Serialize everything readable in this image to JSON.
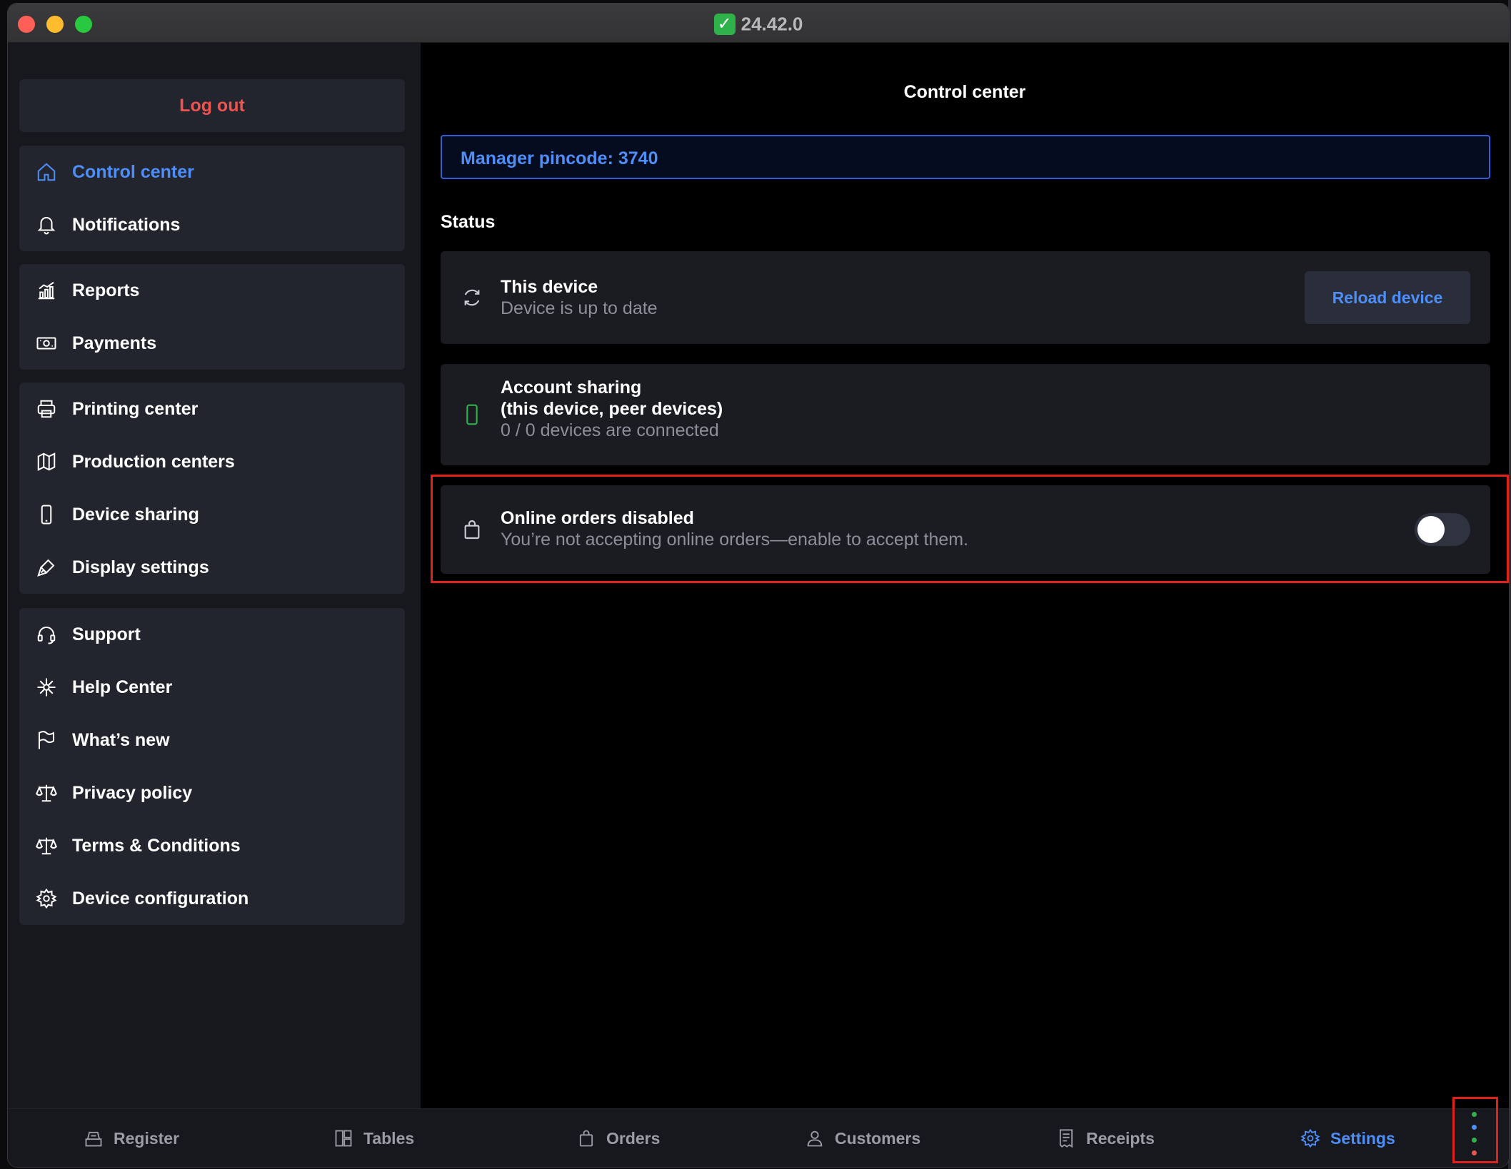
{
  "window": {
    "title": "24.42.0",
    "title_icon": "check-mark-icon"
  },
  "sidebar": {
    "logout_label": "Log out",
    "groups": [
      [
        {
          "label": "Control center",
          "icon": "home-icon",
          "active": true
        },
        {
          "label": "Notifications",
          "icon": "bell-icon"
        }
      ],
      [
        {
          "label": "Reports",
          "icon": "chart-icon"
        },
        {
          "label": "Payments",
          "icon": "cash-icon"
        }
      ],
      [
        {
          "label": "Printing center",
          "icon": "printer-icon"
        },
        {
          "label": "Production centers",
          "icon": "map-icon"
        },
        {
          "label": "Device sharing",
          "icon": "phone-icon"
        },
        {
          "label": "Display settings",
          "icon": "brush-icon"
        }
      ],
      [
        {
          "label": "Support",
          "icon": "headset-icon"
        },
        {
          "label": "Help Center",
          "icon": "sparkle-icon"
        },
        {
          "label": "What’s new",
          "icon": "flag-icon"
        },
        {
          "label": "Privacy policy",
          "icon": "scale-icon"
        },
        {
          "label": "Terms & Conditions",
          "icon": "scale-icon"
        },
        {
          "label": "Device configuration",
          "icon": "gear-icon"
        }
      ]
    ]
  },
  "main": {
    "title": "Control center",
    "pincode": "Manager pincode: 3740",
    "status_heading": "Status",
    "cards": {
      "device": {
        "title": "This device",
        "subtitle": "Device is up to date",
        "button": "Reload device",
        "icon": "sync-icon"
      },
      "sharing": {
        "title_line1": "Account sharing",
        "title_line2": "(this device, peer devices)",
        "subtitle": "0 / 0 devices are connected",
        "icon": "phone-icon"
      },
      "online_orders": {
        "title": "Online orders disabled",
        "subtitle": "You’re not accepting online orders—enable to accept them.",
        "icon": "bag-icon",
        "toggle_on": false
      }
    }
  },
  "bottom_tabs": [
    {
      "label": "Register",
      "icon": "register-icon"
    },
    {
      "label": "Tables",
      "icon": "tables-icon"
    },
    {
      "label": "Orders",
      "icon": "bag-icon"
    },
    {
      "label": "Customers",
      "icon": "user-icon"
    },
    {
      "label": "Receipts",
      "icon": "receipt-icon"
    },
    {
      "label": "Settings",
      "icon": "gear-icon",
      "active": true
    }
  ],
  "colors": {
    "accent": "#4f8ef7",
    "danger": "#ef5350",
    "card_bg": "#1a1c22",
    "sidebar_bg": "#16181e",
    "highlight": "#e0201a"
  }
}
